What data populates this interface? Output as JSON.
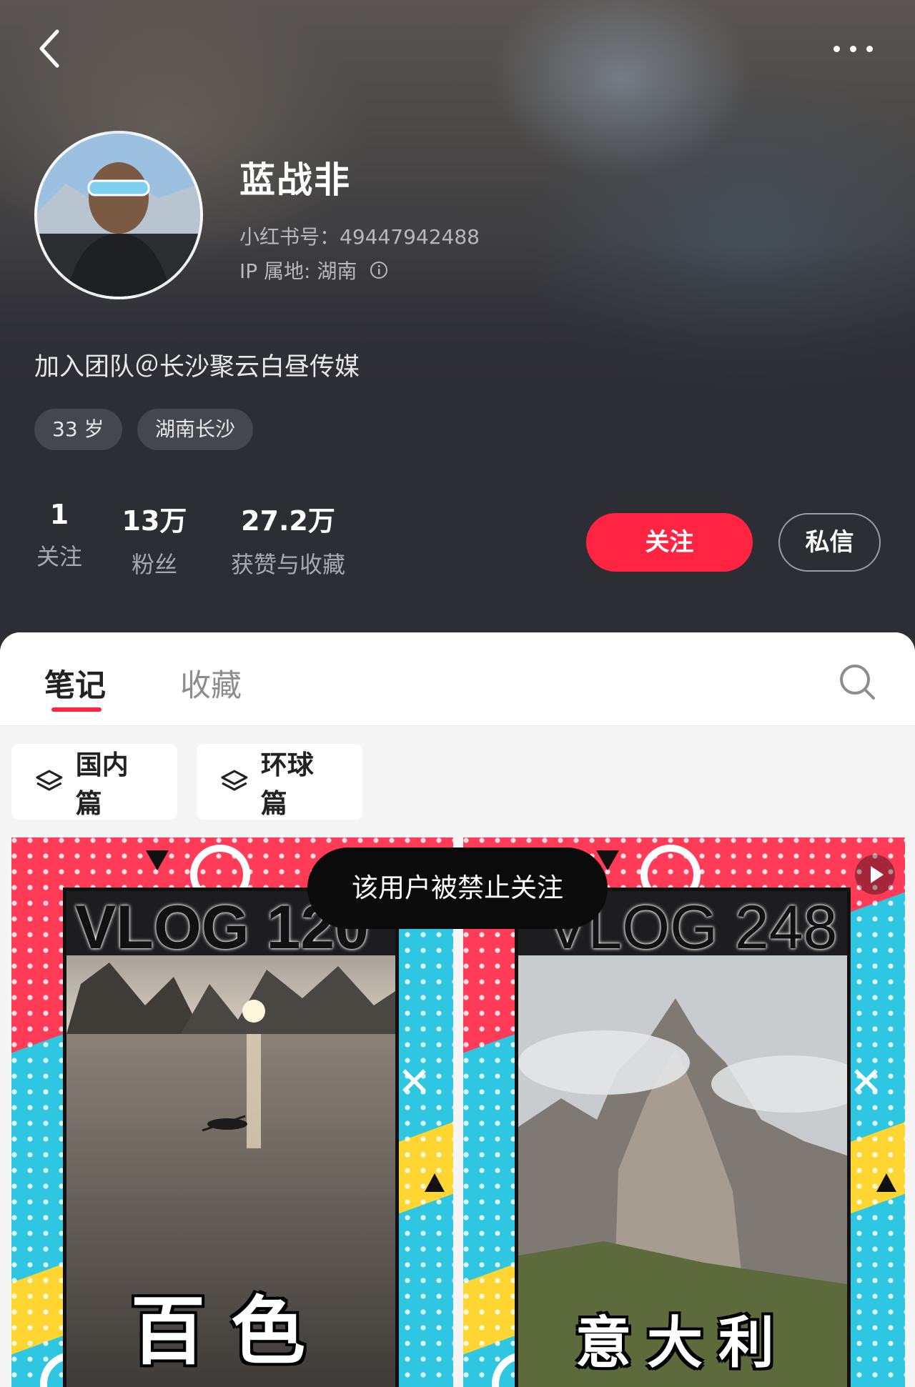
{
  "profile": {
    "name": "蓝战非",
    "red_id": "小红书号：49447942488",
    "ip_location": "IP 属地: 湖南",
    "bio": "加入团队＠长沙聚云白昼传媒",
    "tags": [
      "33 岁",
      "湖南长沙"
    ]
  },
  "stats": [
    {
      "value": "1",
      "label": "关注"
    },
    {
      "value": "13万",
      "label": "粉丝"
    },
    {
      "value": "27.2万",
      "label": "获赞与收藏"
    }
  ],
  "actions": {
    "follow_label": "关注",
    "message_label": "私信"
  },
  "tabs": [
    {
      "label": "笔记",
      "active": true
    },
    {
      "label": "收藏",
      "active": false
    }
  ],
  "collections": [
    {
      "label": "国内篇",
      "icon": "layers-icon"
    },
    {
      "label": "环球篇",
      "icon": "layers-icon"
    }
  ],
  "notes": [
    {
      "cover_title": "VLOG 120",
      "cover_caption": "百色",
      "type": "image"
    },
    {
      "cover_title": "VLOG 248",
      "cover_caption": "意大利",
      "type": "video"
    }
  ],
  "toast": "该用户被禁止关注",
  "colors": {
    "accent": "#ff2442",
    "header_bg": "#2d2e34",
    "tag_bg": "#46474d"
  },
  "icons": [
    "back-icon",
    "more-icon",
    "info-icon",
    "search-icon",
    "layers-icon",
    "play-icon"
  ]
}
